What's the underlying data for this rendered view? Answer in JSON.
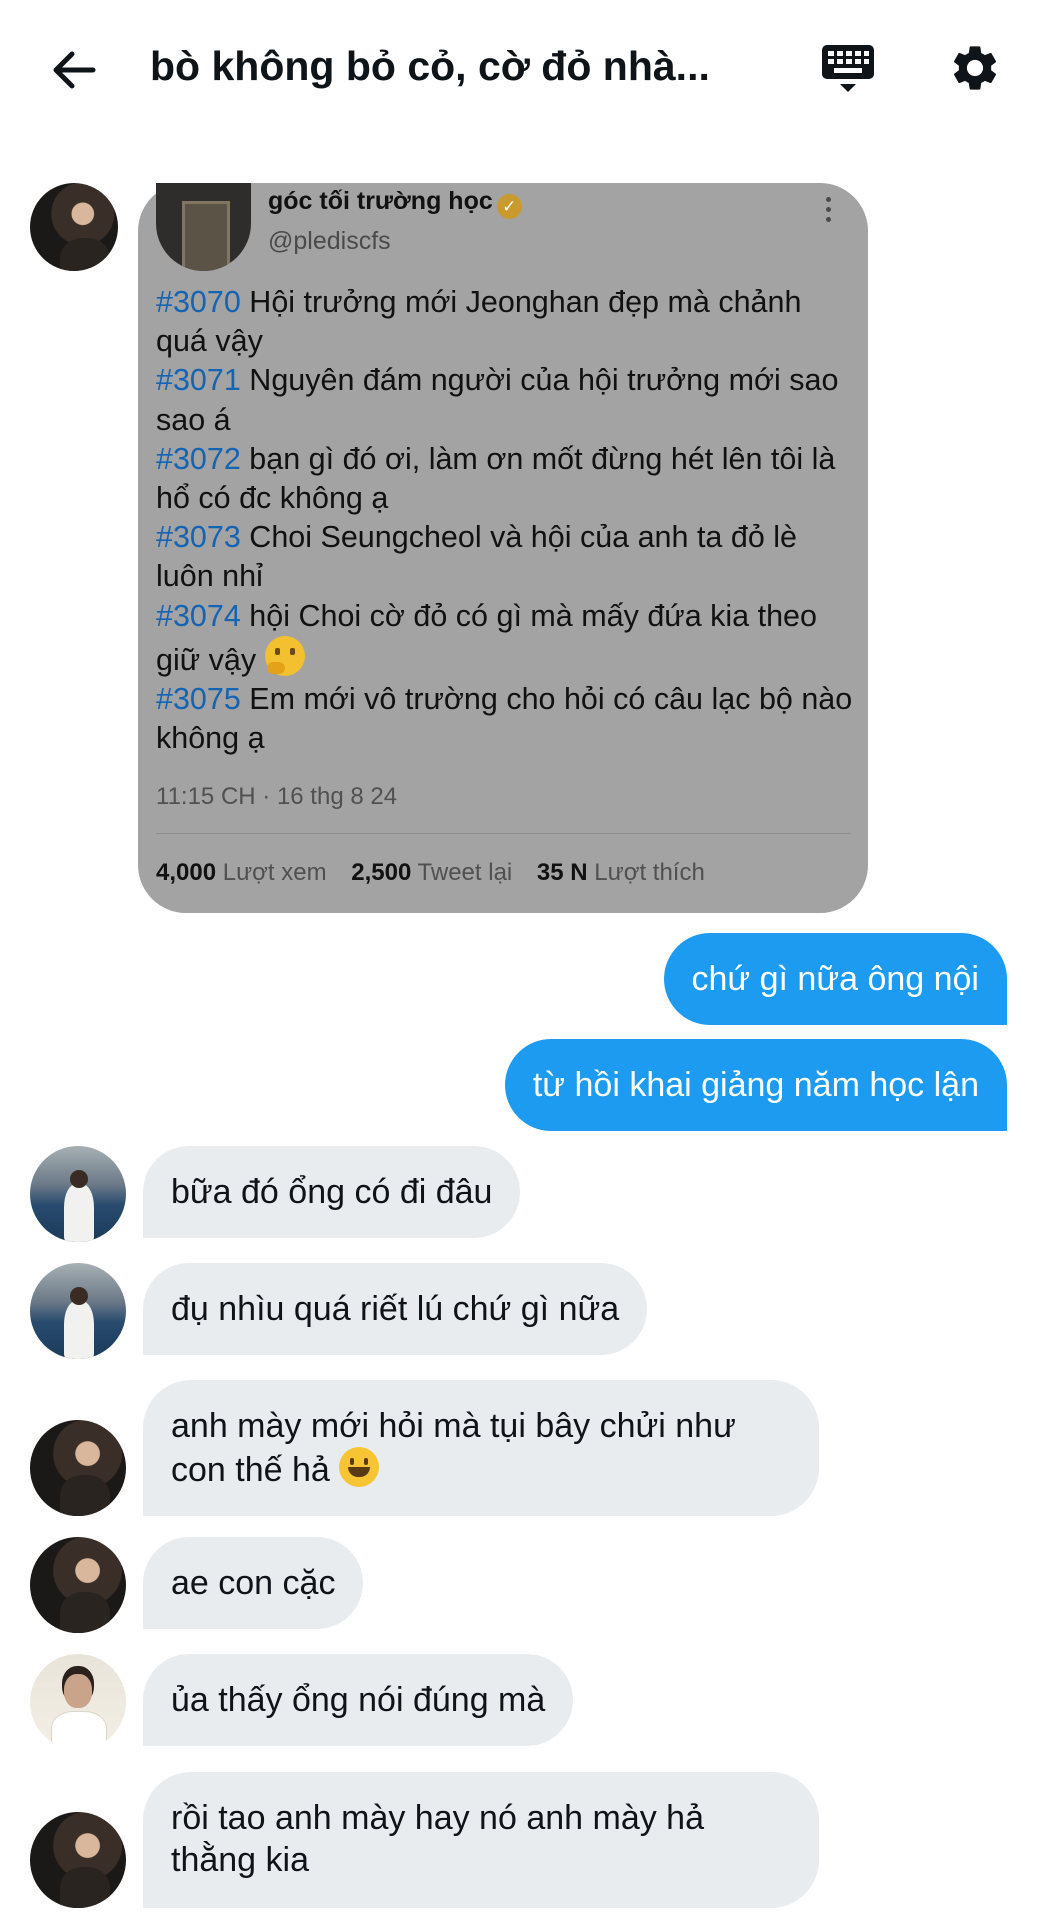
{
  "header": {
    "title": "bò không bỏ cỏ, cờ đỏ nhà...",
    "back_icon": "arrow-left-icon",
    "keyboard_icon": "keyboard-icon",
    "settings_icon": "gear-icon"
  },
  "tweet": {
    "name": "góc tối trường học",
    "verified_icon": "verified-badge-icon",
    "handle": "@plediscfs",
    "items": [
      {
        "tag": "#3070",
        "text": " Hội trưởng mới  Jeonghan đẹp mà chảnh quá vậy"
      },
      {
        "tag": "#3071",
        "text": " Nguyên đám người của hội trưởng mới sao sao á"
      },
      {
        "tag": "#3072",
        "text": " bạn gì đó ơi, làm ơn mốt đừng hét lên tôi là hổ có đc không ạ"
      },
      {
        "tag": "#3073",
        "text": " Choi Seungcheol và hội của anh ta đỏ lè luôn nhỉ"
      },
      {
        "tag": "#3074",
        "text": " hội Choi cờ đỏ có gì mà mấy đứa kia theo giữ vậy "
      },
      {
        "tag": "#3075",
        "text": " Em mới vô trường cho hỏi có câu lạc bộ nào không ạ"
      }
    ],
    "timestamp": "11:15 CH · 16 thg 8 24",
    "views_count": "4,000",
    "views_label": "Lượt xem",
    "retweets_count": "2,500",
    "retweets_label": "Tweet lại",
    "likes_count": "35 N",
    "likes_label": "Lượt thích"
  },
  "messages": [
    {
      "side": "out",
      "text": "chứ gì nữa ông nội"
    },
    {
      "side": "out",
      "text": "từ hồi khai giảng năm học lận"
    },
    {
      "side": "in",
      "text": "bữa đó ổng có đi đâu"
    },
    {
      "side": "in",
      "text": "đụ nhìu quá riết lú chứ gì nữa"
    },
    {
      "side": "in",
      "text": "anh mày mới hỏi mà tụi bây chửi như con thế hả "
    },
    {
      "side": "in",
      "text": "ae con cặc"
    },
    {
      "side": "in",
      "text": "ủa thấy ổng nói đúng mà"
    },
    {
      "side": "in",
      "text": "rồi tao anh mày hay nó anh mày hả thằng kia"
    }
  ],
  "colors": {
    "outgoing_bubble": "#1d9bf0",
    "incoming_bubble": "#e9ecef",
    "tweet_card": "#a3a3a3",
    "hashtag": "#1564b3"
  }
}
